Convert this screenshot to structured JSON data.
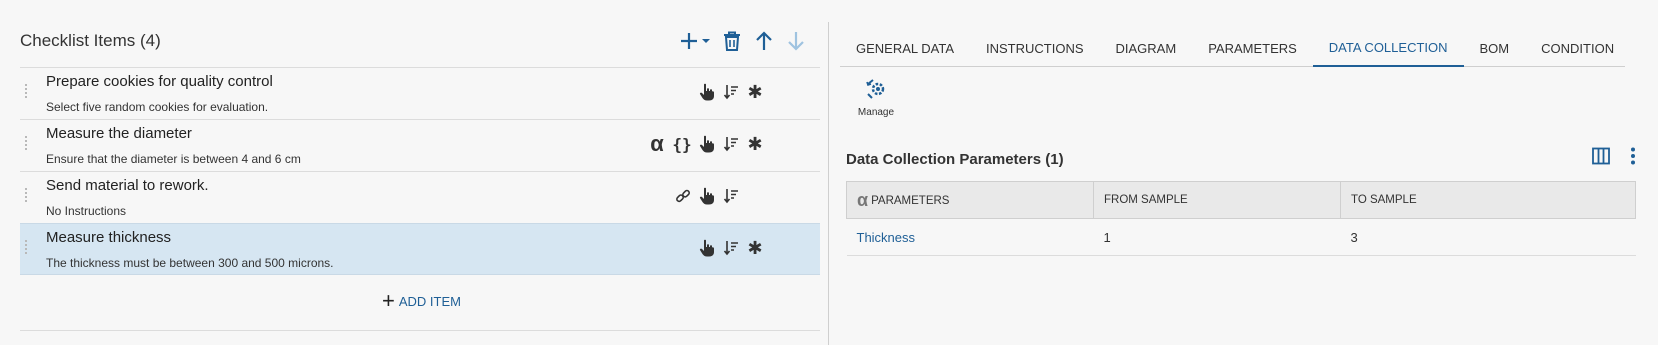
{
  "checklist": {
    "title": "Checklist Items (4)",
    "items": [
      {
        "title": "Prepare cookies for quality control",
        "desc": "Select five random cookies for evaluation.",
        "icons": [
          "hand-pointer-icon",
          "sort-icon",
          "asterisk-icon"
        ]
      },
      {
        "title": "Measure the diameter",
        "desc": "Ensure that the diameter is between 4 and 6 cm",
        "icons": [
          "alpha-icon",
          "braces-icon",
          "hand-pointer-icon",
          "sort-icon",
          "asterisk-icon"
        ]
      },
      {
        "title": "Send material to rework.",
        "desc": "No Instructions",
        "icons": [
          "link-icon",
          "hand-pointer-icon",
          "sort-icon"
        ]
      },
      {
        "title": "Measure thickness",
        "desc": "The thickness must be between 300 and 500 microns.",
        "icons": [
          "hand-pointer-icon",
          "sort-icon",
          "asterisk-icon"
        ],
        "selected": true
      }
    ],
    "add_item_label": "ADD ITEM"
  },
  "toolbar": {
    "icons": [
      "plus-dropdown-icon",
      "trash-icon",
      "arrow-up-icon",
      "arrow-down-icon"
    ]
  },
  "tabs": [
    "GENERAL DATA",
    "INSTRUCTIONS",
    "DIAGRAM",
    "PARAMETERS",
    "DATA COLLECTION",
    "BOM",
    "CONDITION"
  ],
  "active_tab": "DATA COLLECTION",
  "manage": {
    "label": "Manage"
  },
  "data_collection": {
    "title": "Data Collection Parameters (1)",
    "columns": [
      "PARAMETERS",
      "FROM SAMPLE",
      "TO SAMPLE"
    ],
    "rows": [
      {
        "parameter": "Thickness",
        "from": "1",
        "to": "3"
      }
    ]
  },
  "colors": {
    "accent": "#1f5f96",
    "selected_row": "#d6e6f2",
    "disabled_arrow": "#9fc3e0"
  }
}
